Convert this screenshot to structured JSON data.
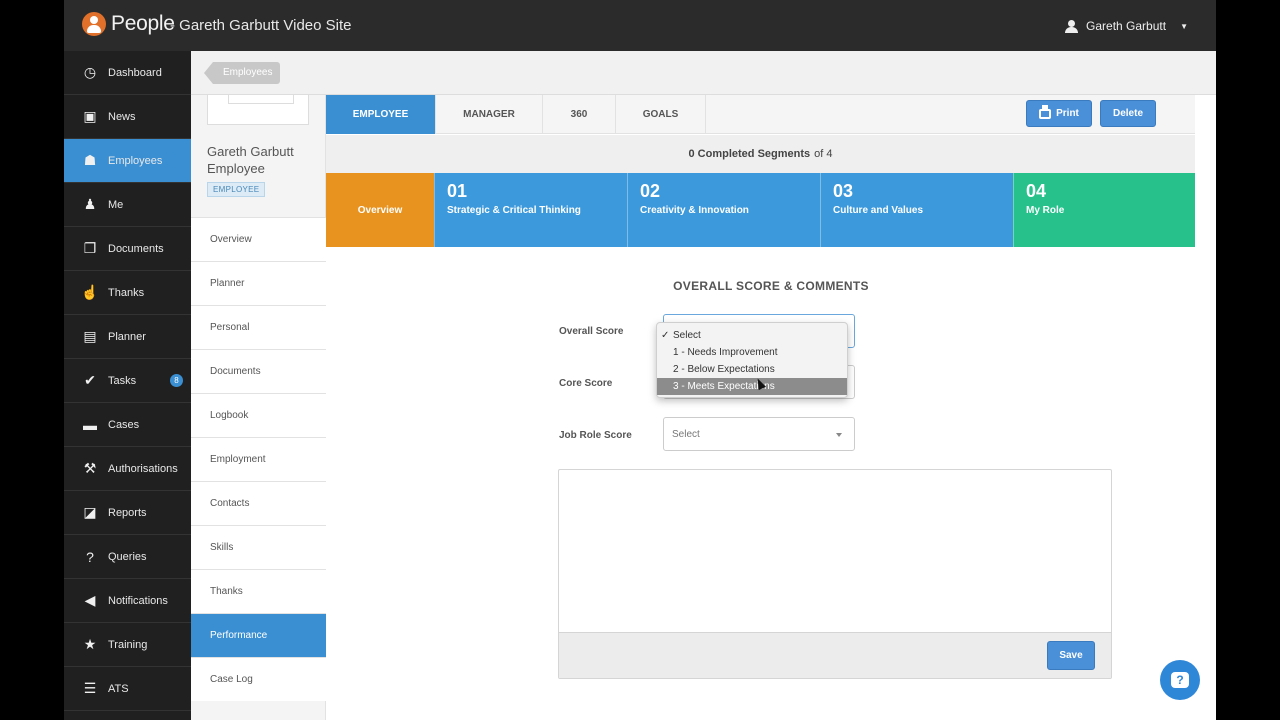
{
  "topbar": {
    "brand": "People",
    "site": "- Gareth Garbutt Video Site",
    "user_name": "Gareth Garbutt",
    "user_icon": "user-icon"
  },
  "sidenav": {
    "items": [
      {
        "label": "Dashboard",
        "icon": "dashboard-icon",
        "glyph": "◷"
      },
      {
        "label": "News",
        "icon": "tv-icon",
        "glyph": "▣"
      },
      {
        "label": "Employees",
        "icon": "people-icon",
        "glyph": "☗",
        "active": true
      },
      {
        "label": "Me",
        "icon": "person-icon",
        "glyph": "♟"
      },
      {
        "label": "Documents",
        "icon": "documents-icon",
        "glyph": "❐"
      },
      {
        "label": "Thanks",
        "icon": "thumbs-up-icon",
        "glyph": "☝"
      },
      {
        "label": "Planner",
        "icon": "planner-icon",
        "glyph": "▤"
      },
      {
        "label": "Tasks",
        "icon": "check-icon",
        "glyph": "✔",
        "badge": "8"
      },
      {
        "label": "Cases",
        "icon": "briefcase-icon",
        "glyph": "▬"
      },
      {
        "label": "Authorisations",
        "icon": "gavel-icon",
        "glyph": "⚒"
      },
      {
        "label": "Reports",
        "icon": "chart-icon",
        "glyph": "◪"
      },
      {
        "label": "Queries",
        "icon": "question-icon",
        "glyph": "?"
      },
      {
        "label": "Notifications",
        "icon": "megaphone-icon",
        "glyph": "◀"
      },
      {
        "label": "Training",
        "icon": "star-icon",
        "glyph": "★"
      },
      {
        "label": "ATS",
        "icon": "list-icon",
        "glyph": "☰"
      }
    ]
  },
  "breadcrumb": {
    "label": "Employees"
  },
  "profile": {
    "name": "Gareth Garbutt Employee",
    "tag": "EMPLOYEE",
    "menu": [
      "Overview",
      "Planner",
      "Personal",
      "Documents",
      "Logbook",
      "Employment",
      "Contacts",
      "Skills",
      "Thanks",
      "Performance",
      "Case Log"
    ],
    "active": "Performance"
  },
  "tabs": [
    "EMPLOYEE",
    "MANAGER",
    "360",
    "GOALS"
  ],
  "buttons": {
    "print": "Print",
    "delete": "Delete"
  },
  "segments_summary": {
    "count": "0 Completed Segments",
    "suffix": "of 4"
  },
  "segments": [
    {
      "num": "",
      "label": "Overview",
      "color": "#e8931f"
    },
    {
      "num": "01",
      "label": "Strategic & Critical Thinking",
      "color": "#3b99dc"
    },
    {
      "num": "02",
      "label": "Creativity & Innovation",
      "color": "#3b99dc"
    },
    {
      "num": "03",
      "label": "Culture and Values",
      "color": "#3b99dc"
    },
    {
      "num": "04",
      "label": "My Role",
      "color": "#27c28c"
    }
  ],
  "form": {
    "title": "OVERALL SCORE & COMMENTS",
    "overall_label": "Overall Score",
    "core_label": "Core Score",
    "job_role_label": "Job Role Score",
    "job_role_value": "Select",
    "save": "Save"
  },
  "dropdown": {
    "options": [
      "Select",
      "1 - Needs Improvement",
      "2 - Below Expectations",
      "3 - Meets Expectations"
    ],
    "checked": "Select",
    "highlighted": "3 - Meets Expectations"
  },
  "help_icon": "help-chat-icon"
}
